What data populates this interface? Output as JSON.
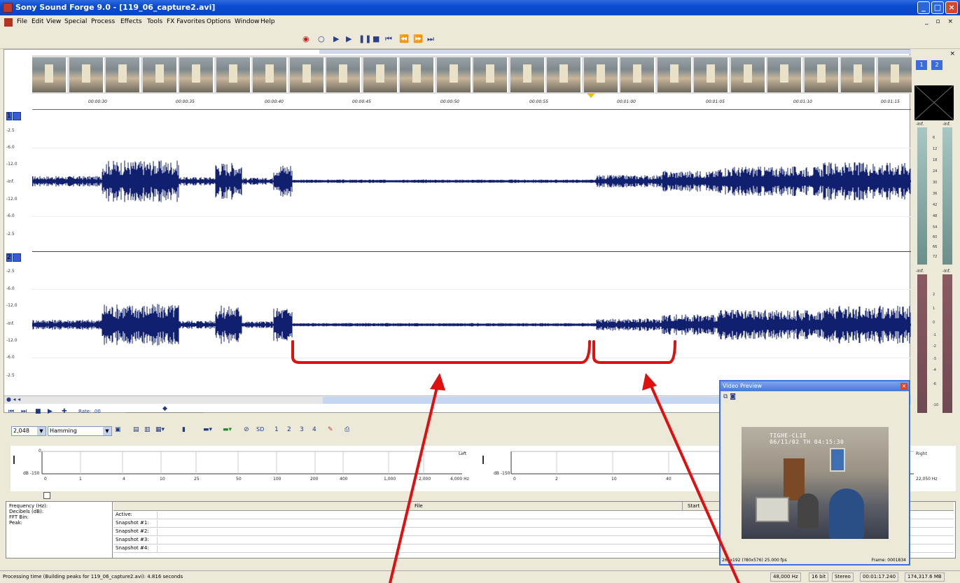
{
  "window": {
    "title": "Sony Sound Forge 9.0 - [119_06_capture2.avi]"
  },
  "menu": [
    "File",
    "Edit",
    "View",
    "Special",
    "Process",
    "Effects",
    "Tools",
    "FX Favorites",
    "Options",
    "Window",
    "Help"
  ],
  "ruler": [
    "00:00:30",
    "00:00:35",
    "00:00:40",
    "00:00:45",
    "00:00:50",
    "00:00:55",
    "00:01:00",
    "00:01:05",
    "00:01:10",
    "00:01:15"
  ],
  "db_labels": [
    "-2.5",
    "-6.0",
    "-12.0",
    "-Inf.",
    "-12.0",
    "-6.0",
    "-2.5"
  ],
  "channels": [
    "1",
    "2"
  ],
  "meters": {
    "top_left": "-Inf.",
    "top_right": "-Inf.",
    "bottom_left": "-Inf.",
    "bottom_right": "-Inf.",
    "ticks_top": [
      "6",
      "12",
      "18",
      "24",
      "30",
      "36",
      "42",
      "48",
      "54",
      "60",
      "66",
      "72"
    ],
    "ticks_bottom": [
      "2",
      "1",
      "0",
      "-1",
      "-2",
      "-3",
      "-4",
      "-6",
      "-10"
    ]
  },
  "transport": {
    "rate_label": "Rate: .00"
  },
  "spectrum": {
    "fft_size": "2,048",
    "window": "Hamming",
    "snapshots": [
      "1",
      "2",
      "3",
      "4"
    ],
    "sd_label": "SD",
    "left_label": "Left",
    "right_label": "Right",
    "y_top": "0",
    "y_bottom": "dB -150",
    "x_left": [
      "0",
      "1",
      "4",
      "10",
      "25",
      "50",
      "100",
      "200",
      "400",
      "1,000",
      "2,000",
      "4,000 Hz"
    ],
    "x_right": [
      "0",
      "2",
      "10",
      "40",
      "22,050 Hz"
    ],
    "y_bottom_right": "dB -150"
  },
  "table": {
    "left_labels": [
      "Frequency (Hz):",
      "Decibels (dB):",
      "FFT Bin:",
      "Peak:"
    ],
    "col_file": "File",
    "col_start": "Start",
    "rows": [
      "Active:",
      "Snapshot #1:",
      "Snapshot #2:",
      "Snapshot #3:",
      "Snapshot #4:"
    ]
  },
  "video_preview": {
    "title": "Video Preview",
    "overlay_line1": "TIGHE-CL1E",
    "overlay_line2": "06/11/02 TH 04:15:30",
    "status_left": "262x192 (?80x576) 25.000 fps",
    "status_right": "Frame: 0001834"
  },
  "statusbar": {
    "message": "Processing time (Building peaks for 119_06_capture2.avi): 4.816 seconds",
    "cells": [
      "48,000 Hz",
      "16 bit",
      "Stereo",
      "00:01:17.240",
      "174,317.6 MB"
    ]
  },
  "colors": {
    "waveform": "#101f6e",
    "annotation": "#e01010",
    "title_bar": "#0a4bd0"
  }
}
